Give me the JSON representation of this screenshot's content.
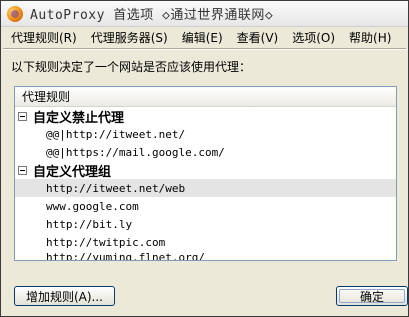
{
  "window": {
    "title": "AutoProxy 首选项  ◇通过世界通联网◇"
  },
  "menubar": {
    "items": [
      {
        "name": "proxy-rules",
        "label": "代理规则(R)"
      },
      {
        "name": "proxy-servers",
        "label": "代理服务器(S)"
      },
      {
        "name": "edit",
        "label": "编辑(E)"
      },
      {
        "name": "view",
        "label": "查看(V)"
      },
      {
        "name": "options",
        "label": "选项(O)"
      },
      {
        "name": "help",
        "label": "帮助(H)"
      }
    ]
  },
  "main": {
    "description": "以下规则决定了一个网站是否应该使用代理：",
    "tree": {
      "column_header": "代理规则",
      "groups": [
        {
          "title": "自定义禁止代理",
          "rules": [
            "@@|http://itweet.net/",
            "@@|https://mail.google.com/"
          ]
        },
        {
          "title": "自定义代理组",
          "rules": [
            "http://itweet.net/web",
            "www.google.com",
            "http://bit.ly",
            "http://twitpic.com",
            "http://yuming.flnet.org/"
          ]
        }
      ]
    }
  },
  "buttons": {
    "add_rule": "增加规则(A)...",
    "ok": "确定"
  }
}
